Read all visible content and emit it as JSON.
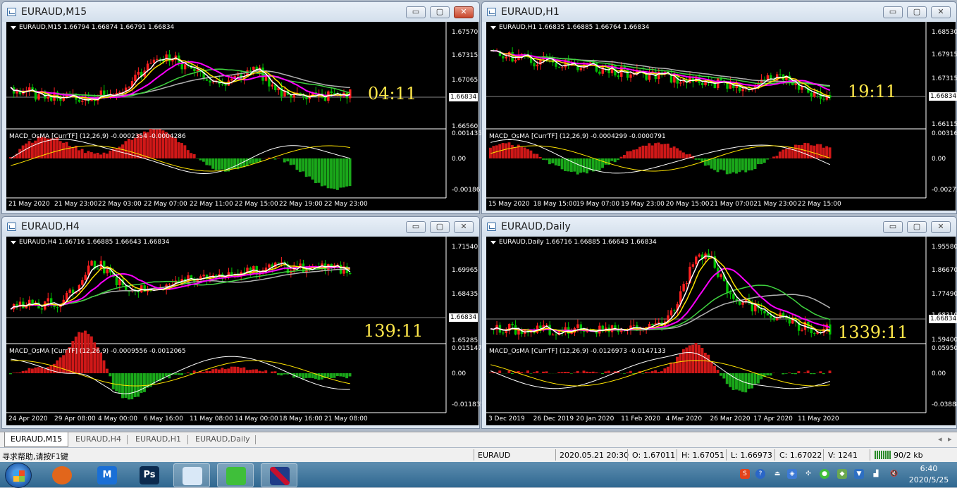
{
  "windows": [
    {
      "id": "m15",
      "title": "EURAUD,M15",
      "symbol_line": "EURAUD,M15  1.66794 1.66874 1.66791 1.66834",
      "macd_label": "MACD_OsMA [CurrTF] (12,26,9) -0.0002354 -0.0004286",
      "price_ticks": [
        "1.67570",
        "1.67315",
        "1.67065",
        "1.66560"
      ],
      "current_price": "1.66834",
      "macd_ticks": [
        "0.001435",
        "0.00",
        "-0.00186"
      ],
      "time_labels": [
        "21 May 2020",
        "21 May 23:00",
        "22 May 03:00",
        "22 May 07:00",
        "22 May 11:00",
        "22 May 15:00",
        "22 May 19:00",
        "22 May 23:00"
      ],
      "timer": "04:11",
      "active": true
    },
    {
      "id": "h1",
      "title": "EURAUD,H1",
      "symbol_line": "EURAUD,H1  1.66835 1.66885 1.66764 1.66834",
      "macd_label": "MACD_OsMA [CurrTF] (12,26,9) -0.0004299 -0.0000791",
      "price_ticks": [
        "1.68530",
        "1.67915",
        "1.67315",
        "1.66715",
        "1.66115"
      ],
      "current_price": "1.66834",
      "macd_ticks": [
        "0.0031666",
        "0.00",
        "-0.002732"
      ],
      "time_labels": [
        "15 May 2020",
        "18 May 15:00",
        "19 May 07:00",
        "19 May 23:00",
        "20 May 15:00",
        "21 May 07:00",
        "21 May 23:00",
        "22 May 15:00"
      ],
      "timer": "19:11",
      "active": false
    },
    {
      "id": "h4",
      "title": "EURAUD,H4",
      "symbol_line": "EURAUD,H4  1.66716 1.66885 1.66643 1.66834",
      "macd_label": "MACD_OsMA [CurrTF] (12,26,9) -0.0009556 -0.0012065",
      "price_ticks": [
        "1.71540",
        "1.69965",
        "1.68435",
        "1.65285"
      ],
      "current_price": "1.66834",
      "macd_ticks": [
        "0.0151478",
        "0.00",
        "-0.011835"
      ],
      "time_labels": [
        "24 Apr 2020",
        "29 Apr 08:00",
        "4 May 00:00",
        "6 May 16:00",
        "11 May 08:00",
        "14 May 00:00",
        "18 May 16:00",
        "21 May 08:00"
      ],
      "timer": "139:11",
      "active": false
    },
    {
      "id": "d1",
      "title": "EURAUD,Daily",
      "symbol_line": "EURAUD,Daily  1.66716 1.66885 1.66643 1.66834",
      "macd_label": "MACD_OsMA [CurrTF] (12,26,9) -0.0126973 -0.0147133",
      "price_ticks": [
        "1.95580",
        "1.86670",
        "1.77490",
        "1.68310",
        "1.59400"
      ],
      "current_price": "1.66834",
      "macd_ticks": [
        "0.0595038",
        "0.00",
        "-0.038889"
      ],
      "time_labels": [
        "3 Dec 2019",
        "26 Dec 2019",
        "20 Jan 2020",
        "11 Feb 2020",
        "4 Mar 2020",
        "26 Mar 2020",
        "17 Apr 2020",
        "11 May 2020"
      ],
      "timer": "1339:11",
      "active": false
    }
  ],
  "window_buttons": {
    "minimize": "▭",
    "maximize": "▢",
    "close": "✕"
  },
  "tabs": [
    "EURAUD,M15",
    "EURAUD,H4",
    "EURAUD,H1",
    "EURAUD,Daily"
  ],
  "tab_arrows": {
    "left": "◂",
    "right": "▸"
  },
  "status": {
    "help": "寻求帮助,请按F1键",
    "symbol": "EURAUD",
    "datetime": "2020.05.21 20:30",
    "open": "O: 1.67011",
    "high": "H: 1.67051",
    "low": "L: 1.66973",
    "close": "C: 1.67022",
    "volume": "V: 1241",
    "traffic": "90/2 kb"
  },
  "taskbar": {
    "apps": [
      {
        "name": "firefox",
        "label": "",
        "color": "#e2661b"
      },
      {
        "name": "tencent-meeting",
        "label": "M",
        "color": "#1a6fd6"
      },
      {
        "name": "photoshop",
        "label": "Ps",
        "color": "#0b2a4e"
      },
      {
        "name": "paint",
        "label": "",
        "color": "#d9e8f7"
      },
      {
        "name": "wechat",
        "label": "",
        "color": "#3fbf3a"
      },
      {
        "name": "mt4",
        "label": "",
        "color": "#b3161e"
      }
    ],
    "clock_time": "6:40",
    "clock_date": "2020/5/25"
  },
  "colors": {
    "bull": "#ff2020",
    "bear": "#00c000",
    "ma_fast": "#ffffff",
    "ma_yellow": "#ffe400",
    "ma_magenta": "#ff00ff",
    "ma_green": "#3fd23f",
    "ma_gray": "#b0b0b0",
    "timer": "#ffe84a"
  }
}
